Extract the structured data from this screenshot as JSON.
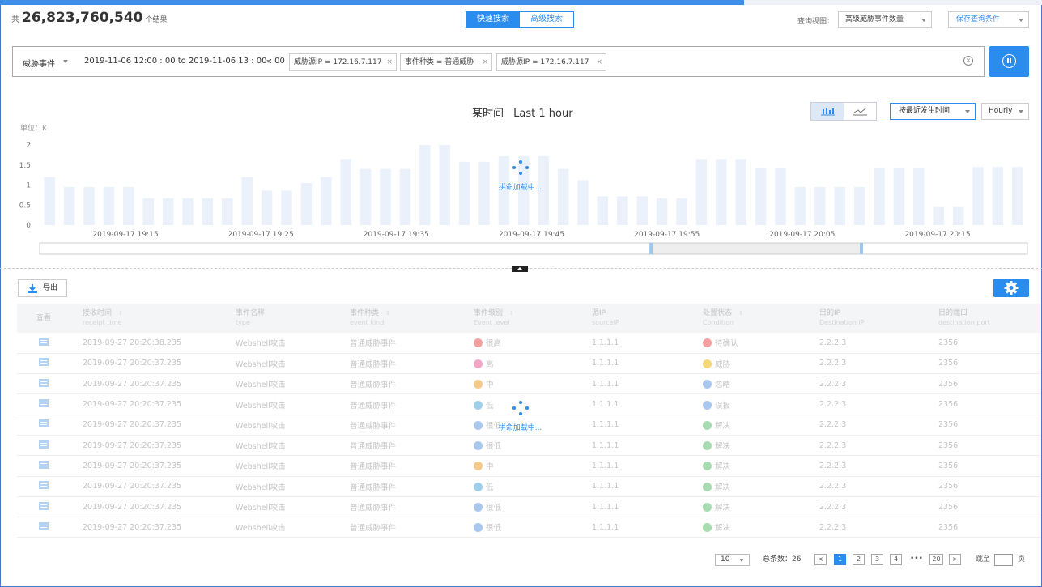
{
  "header": {
    "total_prefix": "共",
    "total_count": "26,823,760,540",
    "total_suffix": "个结果",
    "progress": 0.714,
    "mode_tabs": [
      "快速搜索",
      "高级搜索"
    ],
    "active_mode": 0,
    "view_label": "查询视图：",
    "view_value": "高级威胁事件数量",
    "save_label": "保存查询条件"
  },
  "search": {
    "type": "威胁事件",
    "time_range": "2019-11-06 12:00 : 00  to  2019-11-06 13 : 00 : 00",
    "chips": [
      "威胁源IP = 172.16.7.117",
      "事件种类 = 普通威胁",
      "威胁源IP = 172.16.7.117"
    ],
    "chip_close": "×",
    "clear": "×"
  },
  "chart_header": {
    "title_prefix": "某时间",
    "title_value": "Last 1 hour",
    "sort_value": "按最近发生时间",
    "granularity": "Hourly",
    "unit_label": "单位：K",
    "loading_text": "拼命加载中..."
  },
  "chart_data": {
    "type": "bar",
    "ylabel": "单位：K",
    "ylim": [
      0,
      2
    ],
    "y_ticks": [
      "2",
      "1.5",
      "1",
      "0.5",
      "0"
    ],
    "x_tick_labels": [
      "2019-09-17  19:15",
      "2019-09-17  19:25",
      "2019-09-17  19:35",
      "2019-09-17  19:45",
      "2019-09-17  19:55",
      "2019-09-17  20:05",
      "2019-09-17  20:15"
    ],
    "values": [
      1.2,
      0.95,
      0.95,
      0.95,
      0.95,
      0.67,
      0.67,
      0.67,
      0.67,
      0.67,
      1.2,
      0.86,
      0.86,
      1.05,
      1.2,
      1.65,
      1.4,
      1.4,
      1.4,
      2.0,
      2.0,
      1.58,
      1.58,
      1.72,
      1.72,
      1.72,
      1.4,
      1.12,
      0.72,
      0.72,
      0.72,
      0.67,
      0.67,
      1.65,
      1.65,
      1.65,
      1.42,
      1.42,
      0.95,
      0.95,
      0.95,
      0.95,
      1.42,
      1.42,
      1.42,
      0.45,
      0.45,
      1.45,
      1.45,
      1.45
    ],
    "bar_color": "#eaf1fb",
    "brush_range": [
      0.619,
      0.832
    ]
  },
  "toolbar": {
    "export_label": "导出"
  },
  "table": {
    "columns": [
      {
        "zh": "查看",
        "en": "",
        "sortable": false
      },
      {
        "zh": "接收时间",
        "en": "receipt time",
        "sortable": true
      },
      {
        "zh": "事件名称",
        "en": "type",
        "sortable": false
      },
      {
        "zh": "事件种类",
        "en": "event kind",
        "sortable": true
      },
      {
        "zh": "事件级别",
        "en": "Event level",
        "sortable": true
      },
      {
        "zh": "源IP",
        "en": "sourceIP",
        "sortable": false
      },
      {
        "zh": "处置状态",
        "en": "Condition",
        "sortable": true
      },
      {
        "zh": "目的IP",
        "en": "Destination IP",
        "sortable": false
      },
      {
        "zh": "目的端口",
        "en": "destination port",
        "sortable": false
      }
    ],
    "rows": [
      {
        "time": "2019-09-27  20:20:38.235",
        "name": "Webshell攻击",
        "kind": "普通威胁事件",
        "level": "很高",
        "level_color": "#f3a0a0",
        "src": "1.1.1.1",
        "status": "待确认",
        "status_color": "#f3a0a0",
        "dst": "2.2.2.3",
        "port": "2356"
      },
      {
        "time": "2019-09-27  20:20:37.235",
        "name": "Webshell攻击",
        "kind": "普通威胁事件",
        "level": "高",
        "level_color": "#f3a8c8",
        "src": "1.1.1.1",
        "status": "威胁",
        "status_color": "#f5d87a",
        "dst": "2.2.2.3",
        "port": "2356"
      },
      {
        "time": "2019-09-27  20:20:37.235",
        "name": "Webshell攻击",
        "kind": "普通威胁事件",
        "level": "中",
        "level_color": "#f5c98a",
        "src": "1.1.1.1",
        "status": "忽略",
        "status_color": "#a9c8ee",
        "dst": "2.2.2.3",
        "port": "2356"
      },
      {
        "time": "2019-09-27  20:20:37.235",
        "name": "Webshell攻击",
        "kind": "普通威胁事件",
        "level": "低",
        "level_color": "#9ed0ee",
        "src": "1.1.1.1",
        "status": "误报",
        "status_color": "#a9c8ee",
        "dst": "2.2.2.3",
        "port": "2356"
      },
      {
        "time": "2019-09-27  20:20:37.235",
        "name": "Webshell攻击",
        "kind": "普通威胁事件",
        "level": "很低",
        "level_color": "#a9c8ee",
        "src": "1.1.1.1",
        "status": "解决",
        "status_color": "#a8dcb0",
        "dst": "2.2.2.3",
        "port": "2356"
      },
      {
        "time": "2019-09-27  20:20:37.235",
        "name": "Webshell攻击",
        "kind": "普通威胁事件",
        "level": "很低",
        "level_color": "#a9c8ee",
        "src": "1.1.1.1",
        "status": "解决",
        "status_color": "#a8dcb0",
        "dst": "2.2.2.3",
        "port": "2356"
      },
      {
        "time": "2019-09-27  20:20:37.235",
        "name": "Webshell攻击",
        "kind": "普通威胁事件",
        "level": "中",
        "level_color": "#f5c98a",
        "src": "1.1.1.1",
        "status": "解决",
        "status_color": "#a8dcb0",
        "dst": "2.2.2.3",
        "port": "2356"
      },
      {
        "time": "2019-09-27  20:20:37.235",
        "name": "Webshell攻击",
        "kind": "普通威胁事件",
        "level": "低",
        "level_color": "#9ed0ee",
        "src": "1.1.1.1",
        "status": "解决",
        "status_color": "#a8dcb0",
        "dst": "2.2.2.3",
        "port": "2356"
      },
      {
        "time": "2019-09-27  20:20:37.235",
        "name": "Webshell攻击",
        "kind": "普通威胁事件",
        "level": "很低",
        "level_color": "#a9c8ee",
        "src": "1.1.1.1",
        "status": "解决",
        "status_color": "#a8dcb0",
        "dst": "2.2.2.3",
        "port": "2356"
      },
      {
        "time": "2019-09-27  20:20:37.235",
        "name": "Webshell攻击",
        "kind": "普通威胁事件",
        "level": "很低",
        "level_color": "#a9c8ee",
        "src": "1.1.1.1",
        "status": "解决",
        "status_color": "#a8dcb0",
        "dst": "2.2.2.3",
        "port": "2356"
      }
    ],
    "loading_text": "拼命加载中..."
  },
  "pagination": {
    "page_size": "10",
    "total_label": "总条数：26",
    "pages": [
      "1",
      "2",
      "3",
      "4"
    ],
    "ellipsis": "•••",
    "last_page": "20",
    "prev": "<",
    "next": ">",
    "current": 0,
    "jump_label": "跳至",
    "page_suffix": "页"
  },
  "accent_color": "#2b8cf0"
}
